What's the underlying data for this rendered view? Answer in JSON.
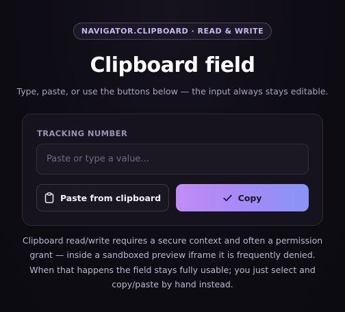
{
  "badge": "NAVIGATOR.CLIPBOARD · READ & WRITE",
  "title": "Clipboard field",
  "subtitle": "Type, paste, or use the buttons below — the input always stays editable.",
  "card": {
    "field_label": "TRACKING NUMBER",
    "input": {
      "value": "",
      "placeholder": "Paste or type a value..."
    },
    "paste_button": {
      "label": "Paste from clipboard",
      "icon": "clipboard-icon"
    },
    "copy_button": {
      "label": "Copy",
      "icon": "check-icon"
    }
  },
  "note": "Clipboard read/write requires a secure context and often a permission grant — inside a sandboxed preview iframe it is frequently denied. When that happens the field stays fully usable; you just select and copy/paste by hand instead.",
  "colors": {
    "background": "#0e0c14",
    "accent_start": "#c08cf4",
    "accent_end": "#8894f7",
    "badge_text": "#c6b8f2"
  }
}
